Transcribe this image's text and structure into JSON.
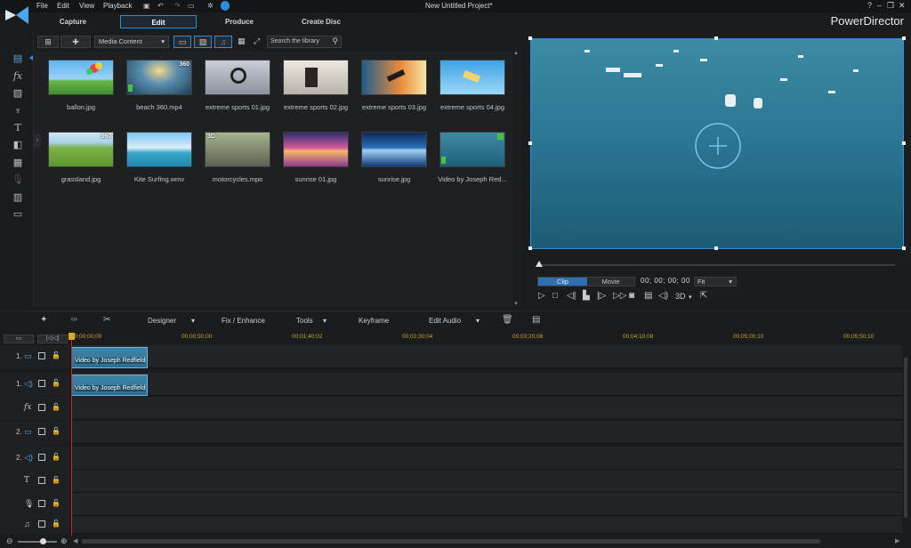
{
  "titlebar": {
    "menu": [
      "File",
      "Edit",
      "View",
      "Playback"
    ],
    "project_title": "New Untitled Project*",
    "app_name": "PowerDirector",
    "help": "?"
  },
  "modes": [
    "Capture",
    "Edit",
    "Produce",
    "Create Disc"
  ],
  "library": {
    "media_select": "Media Content",
    "search_placeholder": "Search the library",
    "items": [
      {
        "label": "ballon.jpg",
        "badge": ""
      },
      {
        "label": "beach 360.mp4",
        "badge": "360"
      },
      {
        "label": "extreme sports 01.jpg",
        "badge": ""
      },
      {
        "label": "extreme sports 02.jpg",
        "badge": ""
      },
      {
        "label": "extreme sports 03.jpg",
        "badge": ""
      },
      {
        "label": "extreme sports 04.jpg",
        "badge": ""
      },
      {
        "label": "grassland.jpg",
        "badge": "360"
      },
      {
        "label": "Kite Surfing.wmv",
        "badge": ""
      },
      {
        "label": "motorcycles.mpo",
        "badge": "3D"
      },
      {
        "label": "sunrise 01.jpg",
        "badge": ""
      },
      {
        "label": "sunrise.jpg",
        "badge": ""
      },
      {
        "label": "Video by Joseph Red...",
        "badge": ""
      }
    ]
  },
  "preview": {
    "clip": "Clip",
    "movie": "Movie",
    "timecode": "00; 00; 00; 00",
    "fit": "Fit",
    "threed": "3D"
  },
  "edit_toolbar": {
    "designer": "Designer",
    "fix": "Fix / Enhance",
    "tools": "Tools",
    "keyframe": "Keyframe",
    "edit_audio": "Edit Audio"
  },
  "ruler": [
    "00;00;00;00",
    "00;00;50;00",
    "00;01;40;02",
    "00;02;30;04",
    "00;03;20;06",
    "00;04;10;08",
    "00;05;00;10",
    "00;05;50;10"
  ],
  "tracks": {
    "t1v": "1.",
    "t1a": "1.",
    "t2v": "2.",
    "t2a": "2.",
    "clip_label": "Video by Joseph Redfield"
  },
  "colors": {
    "accent": "#2d8ee0",
    "clip": "#6fb4e6",
    "playhead": "#d12a2a"
  }
}
